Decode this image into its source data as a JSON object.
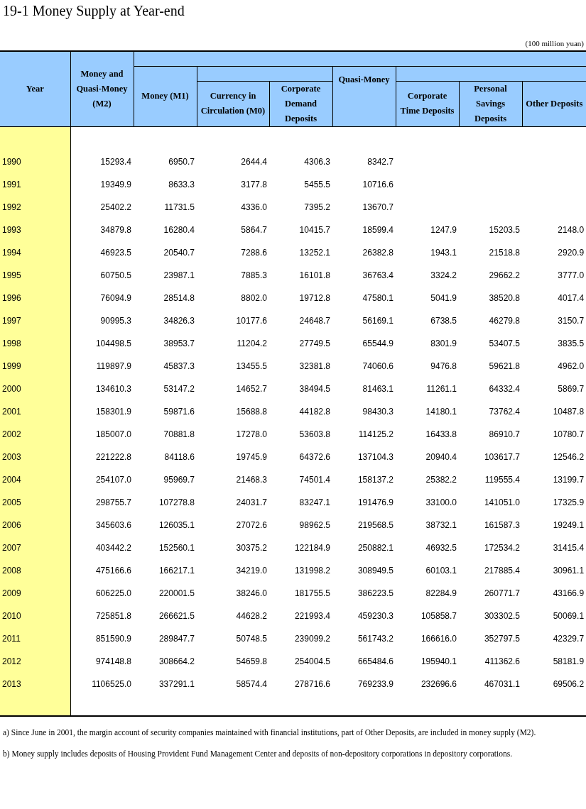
{
  "title": "19-1  Money Supply at Year-end",
  "unit": "(100 million yuan)",
  "columns": [
    {
      "label": "Year"
    },
    {
      "label": "Money and Quasi-Money (M2)"
    },
    {
      "label": "Money (M1)",
      "children": [
        {
          "label": "Currency in Circulation (M0)"
        },
        {
          "label": "Corporate Demand Deposits"
        }
      ]
    },
    {
      "label": "Quasi-Money",
      "children": [
        {
          "label": "Corporate Time Deposits"
        },
        {
          "label": "Personal Savings Deposits"
        },
        {
          "label": "Other Deposits"
        }
      ]
    }
  ],
  "rows": [
    {
      "year": "1990",
      "values": [
        "15293.4",
        "6950.7",
        "2644.4",
        "4306.3",
        "8342.7"
      ]
    },
    {
      "year": "1991",
      "values": [
        "19349.9",
        "8633.3",
        "3177.8",
        "5455.5",
        "10716.6"
      ]
    },
    {
      "year": "1992",
      "values": [
        "25402.2",
        "11731.5",
        "4336.0",
        "7395.2",
        "13670.7"
      ]
    },
    {
      "year": "1993",
      "values": [
        "34879.8",
        "16280.4",
        "5864.7",
        "10415.7",
        "18599.4",
        "1247.9",
        "15203.5",
        "2148.0"
      ]
    },
    {
      "year": "1994",
      "values": [
        "46923.5",
        "20540.7",
        "7288.6",
        "13252.1",
        "26382.8",
        "1943.1",
        "21518.8",
        "2920.9"
      ]
    },
    {
      "year": "1995",
      "values": [
        "60750.5",
        "23987.1",
        "7885.3",
        "16101.8",
        "36763.4",
        "3324.2",
        "29662.2",
        "3777.0"
      ]
    },
    {
      "year": "1996",
      "values": [
        "76094.9",
        "28514.8",
        "8802.0",
        "19712.8",
        "47580.1",
        "5041.9",
        "38520.8",
        "4017.4"
      ]
    },
    {
      "year": "1997",
      "values": [
        "90995.3",
        "34826.3",
        "10177.6",
        "24648.7",
        "56169.1",
        "6738.5",
        "46279.8",
        "3150.7"
      ]
    },
    {
      "year": "1998",
      "values": [
        "104498.5",
        "38953.7",
        "11204.2",
        "27749.5",
        "65544.9",
        "8301.9",
        "53407.5",
        "3835.5"
      ]
    },
    {
      "year": "1999",
      "values": [
        "119897.9",
        "45837.3",
        "13455.5",
        "32381.8",
        "74060.6",
        "9476.8",
        "59621.8",
        "4962.0"
      ]
    },
    {
      "year": "2000",
      "values": [
        "134610.3",
        "53147.2",
        "14652.7",
        "38494.5",
        "81463.1",
        "11261.1",
        "64332.4",
        "5869.7"
      ]
    },
    {
      "year": "2001",
      "values": [
        "158301.9",
        "59871.6",
        "15688.8",
        "44182.8",
        "98430.3",
        "14180.1",
        "73762.4",
        "10487.8"
      ]
    },
    {
      "year": "2002",
      "values": [
        "185007.0",
        "70881.8",
        "17278.0",
        "53603.8",
        "114125.2",
        "16433.8",
        "86910.7",
        "10780.7"
      ]
    },
    {
      "year": "2003",
      "values": [
        "221222.8",
        "84118.6",
        "19745.9",
        "64372.6",
        "137104.3",
        "20940.4",
        "103617.7",
        "12546.2"
      ]
    },
    {
      "year": "2004",
      "values": [
        "254107.0",
        "95969.7",
        "21468.3",
        "74501.4",
        "158137.2",
        "25382.2",
        "119555.4",
        "13199.7"
      ]
    },
    {
      "year": "2005",
      "values": [
        "298755.7",
        "107278.8",
        "24031.7",
        "83247.1",
        "191476.9",
        "33100.0",
        "141051.0",
        "17325.9"
      ]
    },
    {
      "year": "2006",
      "values": [
        "345603.6",
        "126035.1",
        "27072.6",
        "98962.5",
        "219568.5",
        "38732.1",
        "161587.3",
        "19249.1"
      ]
    },
    {
      "year": "2007",
      "values": [
        "403442.2",
        "152560.1",
        "30375.2",
        "122184.9",
        "250882.1",
        "46932.5",
        "172534.2",
        "31415.4"
      ]
    },
    {
      "year": "2008",
      "values": [
        "475166.6",
        "166217.1",
        "34219.0",
        "131998.2",
        "308949.5",
        "60103.1",
        "217885.4",
        "30961.1"
      ]
    },
    {
      "year": "2009",
      "values": [
        "606225.0",
        "220001.5",
        "38246.0",
        "181755.5",
        "386223.5",
        "82284.9",
        "260771.7",
        "43166.9"
      ]
    },
    {
      "year": "2010",
      "values": [
        "725851.8",
        "266621.5",
        "44628.2",
        "221993.4",
        "459230.3",
        "105858.7",
        "303302.5",
        "50069.1"
      ]
    },
    {
      "year": "2011",
      "values": [
        "851590.9",
        "289847.7",
        "50748.5",
        "239099.2",
        "561743.2",
        "166616.0",
        "352797.5",
        "42329.7"
      ]
    },
    {
      "year": "2012",
      "values": [
        "974148.8",
        "308664.2",
        "54659.8",
        "254004.5",
        "665484.6",
        "195940.1",
        "411362.6",
        "58181.9"
      ]
    },
    {
      "year": "2013",
      "values": [
        "1106525.0",
        "337291.1",
        "58574.4",
        "278716.6",
        "769233.9",
        "232696.6",
        "467031.1",
        "69506.2"
      ]
    }
  ],
  "notes": [
    "a) Since June in 2001, the margin account of security companies maintained with financial institutions, part of Other Deposits, are included in money supply (M2).",
    "b) Money supply includes deposits of Housing Provident Fund Management Center and deposits of non-depository corporations in depository corporations."
  ]
}
